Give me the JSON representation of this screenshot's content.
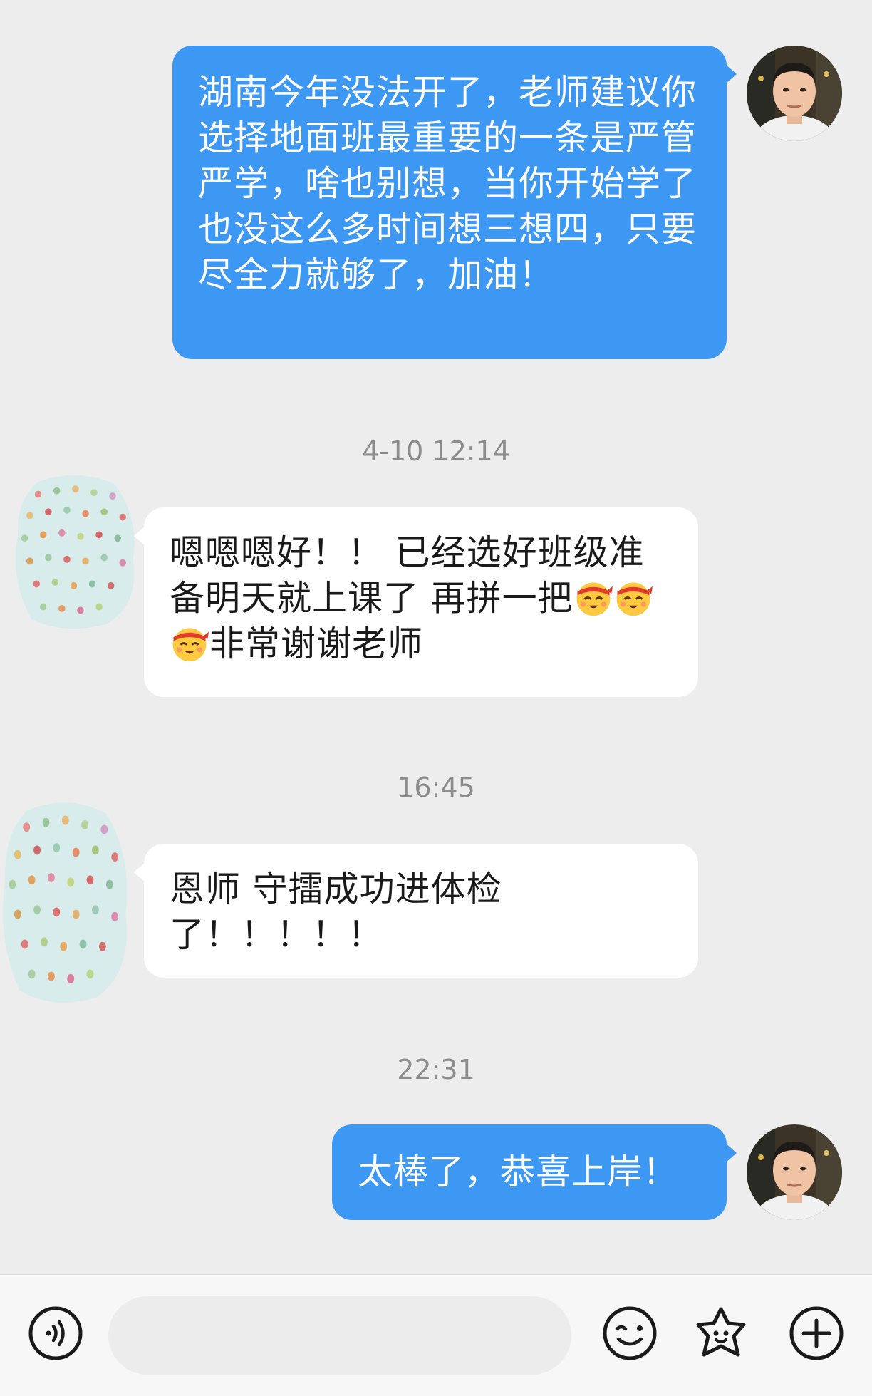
{
  "messages": {
    "msg1": {
      "text": "湖南今年没法开了，老师建议你选择地面班最重要的一条是严管严学，啥也别想，当你开始学了也没这么多时间想三想四，只要尽全力就够了，加油！"
    },
    "ts1": "4-10 12:14",
    "msg2": {
      "text_a": "嗯嗯嗯好！！ 已经选好班级准备明天就上课了 再拼一把",
      "text_b": "非常谢谢老师",
      "emoji": "determined-face-emoji"
    },
    "ts2": "16:45",
    "msg3": {
      "text": "恩师 守擂成功进体检了！！！！！"
    },
    "ts3": "22:31",
    "msg4": {
      "text": "太棒了，恭喜上岸！"
    }
  },
  "input": {
    "placeholder": ""
  },
  "icons": {
    "voice": "voice-wave-icon",
    "emoji": "smile-icon",
    "sticker": "star-face-icon",
    "add": "plus-circle-icon"
  },
  "colors": {
    "outgoing_bubble": "#3d98f3",
    "incoming_bubble": "#ffffff",
    "background": "#ededed"
  }
}
